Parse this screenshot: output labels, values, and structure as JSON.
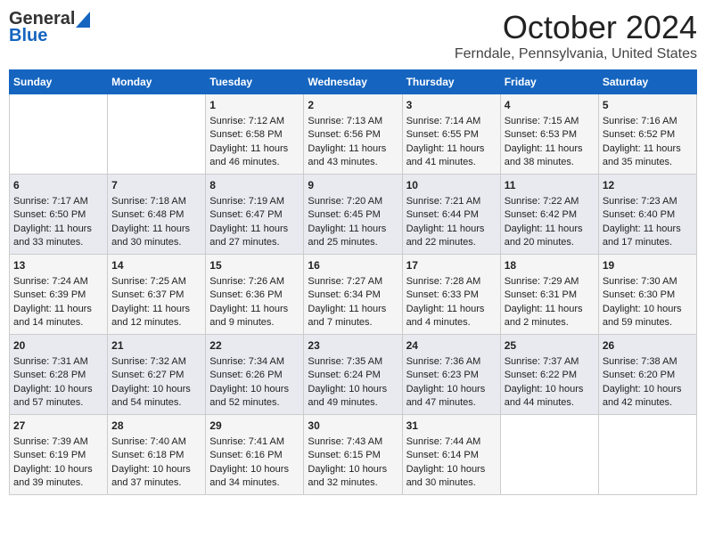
{
  "header": {
    "logo_general": "General",
    "logo_blue": "Blue",
    "month_title": "October 2024",
    "location": "Ferndale, Pennsylvania, United States"
  },
  "days_of_week": [
    "Sunday",
    "Monday",
    "Tuesday",
    "Wednesday",
    "Thursday",
    "Friday",
    "Saturday"
  ],
  "weeks": [
    [
      {
        "day": "",
        "sunrise": "",
        "sunset": "",
        "daylight": ""
      },
      {
        "day": "",
        "sunrise": "",
        "sunset": "",
        "daylight": ""
      },
      {
        "day": "1",
        "sunrise": "Sunrise: 7:12 AM",
        "sunset": "Sunset: 6:58 PM",
        "daylight": "Daylight: 11 hours and 46 minutes."
      },
      {
        "day": "2",
        "sunrise": "Sunrise: 7:13 AM",
        "sunset": "Sunset: 6:56 PM",
        "daylight": "Daylight: 11 hours and 43 minutes."
      },
      {
        "day": "3",
        "sunrise": "Sunrise: 7:14 AM",
        "sunset": "Sunset: 6:55 PM",
        "daylight": "Daylight: 11 hours and 41 minutes."
      },
      {
        "day": "4",
        "sunrise": "Sunrise: 7:15 AM",
        "sunset": "Sunset: 6:53 PM",
        "daylight": "Daylight: 11 hours and 38 minutes."
      },
      {
        "day": "5",
        "sunrise": "Sunrise: 7:16 AM",
        "sunset": "Sunset: 6:52 PM",
        "daylight": "Daylight: 11 hours and 35 minutes."
      }
    ],
    [
      {
        "day": "6",
        "sunrise": "Sunrise: 7:17 AM",
        "sunset": "Sunset: 6:50 PM",
        "daylight": "Daylight: 11 hours and 33 minutes."
      },
      {
        "day": "7",
        "sunrise": "Sunrise: 7:18 AM",
        "sunset": "Sunset: 6:48 PM",
        "daylight": "Daylight: 11 hours and 30 minutes."
      },
      {
        "day": "8",
        "sunrise": "Sunrise: 7:19 AM",
        "sunset": "Sunset: 6:47 PM",
        "daylight": "Daylight: 11 hours and 27 minutes."
      },
      {
        "day": "9",
        "sunrise": "Sunrise: 7:20 AM",
        "sunset": "Sunset: 6:45 PM",
        "daylight": "Daylight: 11 hours and 25 minutes."
      },
      {
        "day": "10",
        "sunrise": "Sunrise: 7:21 AM",
        "sunset": "Sunset: 6:44 PM",
        "daylight": "Daylight: 11 hours and 22 minutes."
      },
      {
        "day": "11",
        "sunrise": "Sunrise: 7:22 AM",
        "sunset": "Sunset: 6:42 PM",
        "daylight": "Daylight: 11 hours and 20 minutes."
      },
      {
        "day": "12",
        "sunrise": "Sunrise: 7:23 AM",
        "sunset": "Sunset: 6:40 PM",
        "daylight": "Daylight: 11 hours and 17 minutes."
      }
    ],
    [
      {
        "day": "13",
        "sunrise": "Sunrise: 7:24 AM",
        "sunset": "Sunset: 6:39 PM",
        "daylight": "Daylight: 11 hours and 14 minutes."
      },
      {
        "day": "14",
        "sunrise": "Sunrise: 7:25 AM",
        "sunset": "Sunset: 6:37 PM",
        "daylight": "Daylight: 11 hours and 12 minutes."
      },
      {
        "day": "15",
        "sunrise": "Sunrise: 7:26 AM",
        "sunset": "Sunset: 6:36 PM",
        "daylight": "Daylight: 11 hours and 9 minutes."
      },
      {
        "day": "16",
        "sunrise": "Sunrise: 7:27 AM",
        "sunset": "Sunset: 6:34 PM",
        "daylight": "Daylight: 11 hours and 7 minutes."
      },
      {
        "day": "17",
        "sunrise": "Sunrise: 7:28 AM",
        "sunset": "Sunset: 6:33 PM",
        "daylight": "Daylight: 11 hours and 4 minutes."
      },
      {
        "day": "18",
        "sunrise": "Sunrise: 7:29 AM",
        "sunset": "Sunset: 6:31 PM",
        "daylight": "Daylight: 11 hours and 2 minutes."
      },
      {
        "day": "19",
        "sunrise": "Sunrise: 7:30 AM",
        "sunset": "Sunset: 6:30 PM",
        "daylight": "Daylight: 10 hours and 59 minutes."
      }
    ],
    [
      {
        "day": "20",
        "sunrise": "Sunrise: 7:31 AM",
        "sunset": "Sunset: 6:28 PM",
        "daylight": "Daylight: 10 hours and 57 minutes."
      },
      {
        "day": "21",
        "sunrise": "Sunrise: 7:32 AM",
        "sunset": "Sunset: 6:27 PM",
        "daylight": "Daylight: 10 hours and 54 minutes."
      },
      {
        "day": "22",
        "sunrise": "Sunrise: 7:34 AM",
        "sunset": "Sunset: 6:26 PM",
        "daylight": "Daylight: 10 hours and 52 minutes."
      },
      {
        "day": "23",
        "sunrise": "Sunrise: 7:35 AM",
        "sunset": "Sunset: 6:24 PM",
        "daylight": "Daylight: 10 hours and 49 minutes."
      },
      {
        "day": "24",
        "sunrise": "Sunrise: 7:36 AM",
        "sunset": "Sunset: 6:23 PM",
        "daylight": "Daylight: 10 hours and 47 minutes."
      },
      {
        "day": "25",
        "sunrise": "Sunrise: 7:37 AM",
        "sunset": "Sunset: 6:22 PM",
        "daylight": "Daylight: 10 hours and 44 minutes."
      },
      {
        "day": "26",
        "sunrise": "Sunrise: 7:38 AM",
        "sunset": "Sunset: 6:20 PM",
        "daylight": "Daylight: 10 hours and 42 minutes."
      }
    ],
    [
      {
        "day": "27",
        "sunrise": "Sunrise: 7:39 AM",
        "sunset": "Sunset: 6:19 PM",
        "daylight": "Daylight: 10 hours and 39 minutes."
      },
      {
        "day": "28",
        "sunrise": "Sunrise: 7:40 AM",
        "sunset": "Sunset: 6:18 PM",
        "daylight": "Daylight: 10 hours and 37 minutes."
      },
      {
        "day": "29",
        "sunrise": "Sunrise: 7:41 AM",
        "sunset": "Sunset: 6:16 PM",
        "daylight": "Daylight: 10 hours and 34 minutes."
      },
      {
        "day": "30",
        "sunrise": "Sunrise: 7:43 AM",
        "sunset": "Sunset: 6:15 PM",
        "daylight": "Daylight: 10 hours and 32 minutes."
      },
      {
        "day": "31",
        "sunrise": "Sunrise: 7:44 AM",
        "sunset": "Sunset: 6:14 PM",
        "daylight": "Daylight: 10 hours and 30 minutes."
      },
      {
        "day": "",
        "sunrise": "",
        "sunset": "",
        "daylight": ""
      },
      {
        "day": "",
        "sunrise": "",
        "sunset": "",
        "daylight": ""
      }
    ]
  ]
}
